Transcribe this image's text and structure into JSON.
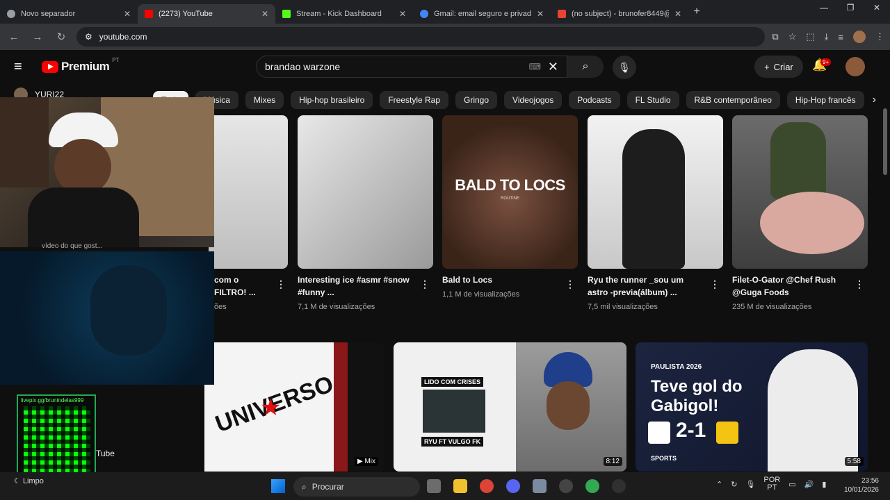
{
  "browser": {
    "tabs": [
      {
        "title": "Novo separador",
        "color": "#9aa0a6"
      },
      {
        "title": "(2273) YouTube",
        "color": "#ff0000"
      },
      {
        "title": "Stream - Kick Dashboard",
        "color": "#53fc18"
      },
      {
        "title": "Gmail: email seguro e privado",
        "color": "#4285f4"
      },
      {
        "title": "(no subject) - brunofer8449@g",
        "color": "#ea4335"
      }
    ],
    "url": "youtube.com"
  },
  "youtube": {
    "brand": "Premium",
    "country": "PT",
    "search_value": "brandao warzone",
    "create_label": "Criar",
    "notif_count": "9+",
    "sidebar_user": "YURI22",
    "chips": [
      "Tudo",
      "Música",
      "Mixes",
      "Hip-hop brasileiro",
      "Freestyle Rap",
      "Gringo",
      "Videojogos",
      "Podcasts",
      "FL Studio",
      "R&B contemporâneo",
      "Hip-Hop francês"
    ],
    "videos": [
      {
        "title": "com o FILTRO! ...",
        "meta": "ões",
        "thumb_color": "#d8d8d8"
      },
      {
        "title": "Interesting ice #asmr #snow #funny ...",
        "meta": "7,1 M de visualizações",
        "thumb_color": "#cfcfcf"
      },
      {
        "title": "Bald to Locs",
        "meta": "1,1 M de visualizações",
        "thumb_color": "#6b4a3a",
        "overlay": "BALD TO LOCS",
        "overlay_sub": "ROUTINE"
      },
      {
        "title": "Ryu the runner _sou um astro -previa(álbum) ...",
        "meta": "7,5 mil visualizações",
        "thumb_color": "#e4e4e4"
      },
      {
        "title": "Filet-O-Gator @Chef Rush @Guga Foods",
        "meta": "235 M de visualizações",
        "thumb_color": "#5a5a5a"
      }
    ],
    "row2": [
      {
        "label": "Mix",
        "overlay": "UNIVERSO"
      },
      {
        "overlay_top": "LIDO COM CRISES",
        "overlay_bottom": "RYU FT VULGO FK",
        "duration": "8:12"
      },
      {
        "kicker": "PAULISTA 2026",
        "headline": "Teve gol do Gabigol!",
        "score": "2-1",
        "network": "SPORTS",
        "duration": "5:58"
      }
    ]
  },
  "overlay": {
    "qr_label": "livepix.gg/brunindelas999",
    "side_text": "Tube",
    "video_caption": "vídeo do que gost..."
  },
  "taskbar": {
    "weather": "Limpo",
    "search_placeholder": "Procurar",
    "lang": "POR",
    "lang2": "PT",
    "time": "23:56",
    "date": "10/01/2026"
  }
}
